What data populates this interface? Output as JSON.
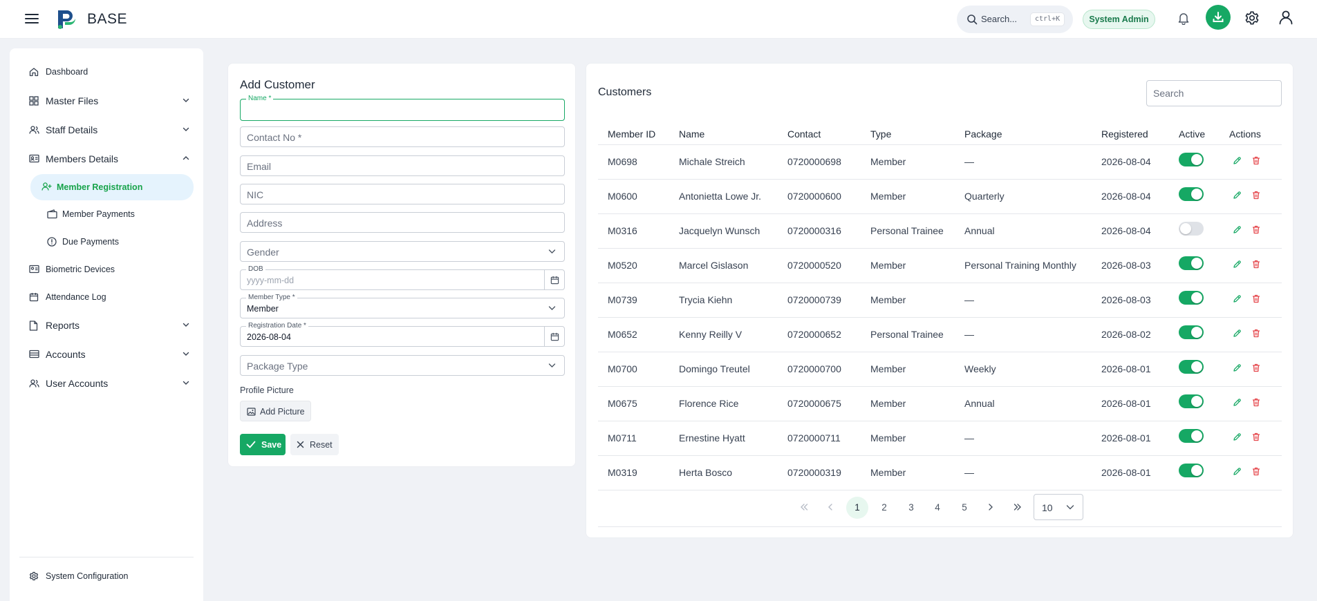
{
  "app": {
    "brand": "BASE"
  },
  "topbar": {
    "search_label": "Search...",
    "search_shortcut": "ctrl+K",
    "role_badge": "System Admin"
  },
  "colors": {
    "accent": "#16a864",
    "danger": "#e5484d",
    "active_bg": "#e5f3fd"
  },
  "sidebar": {
    "items": [
      {
        "label": "Dashboard",
        "icon": "home-icon"
      },
      {
        "label": "Master Files",
        "icon": "grid-icon",
        "expandable": true
      },
      {
        "label": "Staff Details",
        "icon": "users-icon",
        "expandable": true
      },
      {
        "label": "Members Details",
        "icon": "id-card-icon",
        "expandable": true,
        "expanded": true
      },
      {
        "label": "Member Registration",
        "icon": "user-plus-icon",
        "active": true
      },
      {
        "label": "Member Payments",
        "icon": "wallet-icon"
      },
      {
        "label": "Due Payments",
        "icon": "alert-circle-icon"
      },
      {
        "label": "Biometric Devices",
        "icon": "fingerprint-device-icon"
      },
      {
        "label": "Attendance Log",
        "icon": "calendar-icon"
      },
      {
        "label": "Reports",
        "icon": "file-icon",
        "expandable": true
      },
      {
        "label": "Accounts",
        "icon": "ledger-icon",
        "expandable": true
      },
      {
        "label": "User Accounts",
        "icon": "user-group-icon",
        "expandable": true
      }
    ],
    "footer": {
      "label": "System Configuration",
      "icon": "gear-icon"
    }
  },
  "form": {
    "title": "Add Customer",
    "name_label": "Name *",
    "contact_placeholder": "Contact No *",
    "email_placeholder": "Email",
    "nic_placeholder": "NIC",
    "address_placeholder": "Address",
    "gender_placeholder": "Gender",
    "dob_label": "DOB",
    "dob_placeholder": "yyyy-mm-dd",
    "member_type_label": "Member Type *",
    "member_type_value": "Member",
    "registration_date_label": "Registration Date *",
    "registration_date_value": "2026-08-04",
    "package_type_placeholder": "Package Type",
    "profile_picture_label": "Profile Picture",
    "add_picture_label": "Add Picture",
    "save_label": "Save",
    "reset_label": "Reset"
  },
  "table": {
    "title": "Customers",
    "search_placeholder": "Search",
    "columns": [
      "Member ID",
      "Name",
      "Contact",
      "Type",
      "Package",
      "Registered",
      "Active",
      "Actions"
    ],
    "rows": [
      {
        "id": "M0698",
        "name": "Michale Streich",
        "contact": "0720000698",
        "type": "Member",
        "package": "—",
        "registered": "2026-08-04",
        "active": true
      },
      {
        "id": "M0600",
        "name": "Antonietta Lowe Jr.",
        "contact": "0720000600",
        "type": "Member",
        "package": "Quarterly",
        "registered": "2026-08-04",
        "active": true
      },
      {
        "id": "M0316",
        "name": "Jacquelyn Wunsch",
        "contact": "0720000316",
        "type": "Personal Trainee",
        "package": "Annual",
        "registered": "2026-08-04",
        "active": false
      },
      {
        "id": "M0520",
        "name": "Marcel Gislason",
        "contact": "0720000520",
        "type": "Member",
        "package": "Personal Training Monthly",
        "registered": "2026-08-03",
        "active": true
      },
      {
        "id": "M0739",
        "name": "Trycia Kiehn",
        "contact": "0720000739",
        "type": "Member",
        "package": "—",
        "registered": "2026-08-03",
        "active": true
      },
      {
        "id": "M0652",
        "name": "Kenny Reilly V",
        "contact": "0720000652",
        "type": "Personal Trainee",
        "package": "—",
        "registered": "2026-08-02",
        "active": true
      },
      {
        "id": "M0700",
        "name": "Domingo Treutel",
        "contact": "0720000700",
        "type": "Member",
        "package": "Weekly",
        "registered": "2026-08-01",
        "active": true
      },
      {
        "id": "M0675",
        "name": "Florence Rice",
        "contact": "0720000675",
        "type": "Member",
        "package": "Annual",
        "registered": "2026-08-01",
        "active": true
      },
      {
        "id": "M0711",
        "name": "Ernestine Hyatt",
        "contact": "0720000711",
        "type": "Member",
        "package": "—",
        "registered": "2026-08-01",
        "active": true
      },
      {
        "id": "M0319",
        "name": "Herta Bosco",
        "contact": "0720000319",
        "type": "Member",
        "package": "—",
        "registered": "2026-08-01",
        "active": true
      }
    ],
    "pagination": {
      "pages": [
        "1",
        "2",
        "3",
        "4",
        "5"
      ],
      "current": "1",
      "page_size": "10"
    }
  }
}
